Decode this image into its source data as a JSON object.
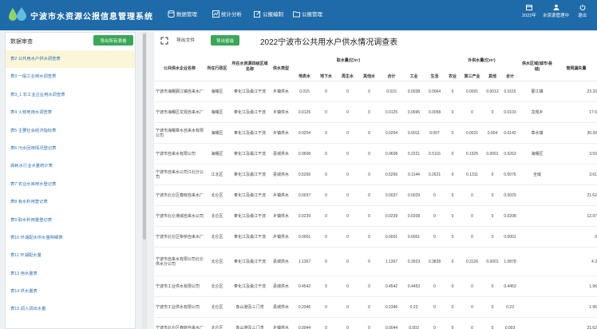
{
  "app": {
    "title": "宁波市水资源公报信息管理系统"
  },
  "nav": [
    {
      "label": "数据管理",
      "icon": "database-icon"
    },
    {
      "label": "统计分析",
      "icon": "chart-icon"
    },
    {
      "label": "公报编制",
      "icon": "edit-icon"
    },
    {
      "label": "公报管理",
      "icon": "folder-icon"
    }
  ],
  "header_right": {
    "year": "2022年",
    "user": "水资源管理中",
    "logout": "退出"
  },
  "sidebar": {
    "title": "数据审查",
    "export_all": "导出所有表格",
    "items": [
      "表2 公共用水户供水调查表",
      "表3 一般工业用水调查表",
      "表3_1 非工业企业用水调查表",
      "表4 火核电用水调查表",
      "表5 主要社会经济指标表",
      "表6 污水回用情况登记表",
      "高耗水行业水量统计表",
      "表7 农业水库用水登记表",
      "表8 有水利用登记表",
      "表9 取水利用量登记表",
      "表10 环湖配水供水量明细表",
      "表11 环湖配水量",
      "表13 用水量表",
      "表14 供水量表",
      "表15 调入调出水量"
    ]
  },
  "main": {
    "export_file": "导出文件",
    "export_sheet": "导出省级",
    "title": "2022宁波市公共用水户供水情况调查表"
  },
  "table": {
    "headers": {
      "company": "公共供水企业名称",
      "district": "所在行政区",
      "zone": "所在水资源四级区域名称",
      "type": "供水类型",
      "intake_group": "取水量(亿m³)",
      "intake_cols": [
        "地表水",
        "地下水",
        "再生水",
        "其他水",
        "合计"
      ],
      "supply_group": "供水量(亿m³)",
      "supply_cols": [
        "工业",
        "生活"
      ],
      "external_group": "外供水量(亿m³)",
      "external_cols": [
        "农业",
        "第三产业",
        "其他",
        "合计"
      ],
      "region": "供水区域(城市/县城)",
      "loss": "管网漏失量"
    },
    "rows": [
      [
        "宁波市海曙鄞江镇自来水厂",
        "海曙区",
        "奉化江及甬江干流",
        "乡镇供水",
        "0.015",
        "0",
        "0",
        "0",
        "0.015",
        "0.0038",
        "0.0064",
        "0",
        "0.0001",
        "0.0012",
        "0.0115",
        "鄞江镇",
        "23.33"
      ],
      [
        "宁波市海曙区龙观自来水厂",
        "海曙区",
        "奉化江及甬江干流",
        "乡镇供水",
        "0.0125",
        "0",
        "0",
        "0",
        "0.0125",
        "0.0045",
        "0.0058",
        "0",
        "0",
        "0",
        "0.0103",
        "龙观乡",
        "17.6"
      ],
      [
        "宁波市海曙章水自来水有限公司",
        "海曙区",
        "奉化江及甬江干流",
        "乡镇供水",
        "0.0204",
        "0",
        "0",
        "0",
        "0.0204",
        "0.0011",
        "0.007",
        "0",
        "0.0021",
        "0.004",
        "0.0142",
        "章水镇",
        "30.39"
      ],
      [
        "宁波市自来水有限公司",
        "海曙区",
        "奉化江及甬江干流",
        "县城供水",
        "0.9608",
        "0",
        "0",
        "0",
        "0.9608",
        "0.2221",
        "0.5116",
        "0",
        "0.1925",
        "0.0001",
        "0.9263",
        "海曙区",
        "3.59"
      ],
      [
        "宁波市自来水公司江北分公司",
        "江北区",
        "奉化江及甬江干流",
        "县城供水",
        "0.5266",
        "0",
        "0",
        "0",
        "0.5266",
        "0.1144",
        "0.2621",
        "0",
        "0.1311",
        "0",
        "0.5076",
        "全域",
        "3.61"
      ],
      [
        "宁波市北仑区春晓自来水厂",
        "北仑区",
        "奉化江及甬江干流",
        "乡镇供水",
        "0.0037",
        "0",
        "0",
        "0",
        "0.0037",
        "0.0029",
        "0",
        "0",
        "0",
        "0",
        "0.0029",
        "",
        "21.62"
      ],
      [
        "宁波市北仑港城自来水公司",
        "北仑区",
        "奉化江及甬江干流",
        "乡镇供水",
        "0.0239",
        "0",
        "0",
        "0",
        "0.0239",
        "0.0208",
        "0",
        "0",
        "0",
        "0",
        "0.0208",
        "",
        "12.97"
      ],
      [
        "宁波市北仑区柴桥自来水厂",
        "北仑区",
        "奉化江及甬江干流",
        "乡镇供水",
        "0.0001",
        "0",
        "0",
        "0",
        "0.0001",
        "0.0001",
        "0",
        "0",
        "0",
        "0",
        "0.0001",
        "",
        "0"
      ],
      [
        "宁波市自来水有限公司北仑供水分公司",
        "北仑区",
        "奉化江及甬江干流",
        "县城供水",
        "1.1367",
        "0",
        "0",
        "0",
        "1.1367",
        "0.3923",
        "0.3828",
        "0",
        "0.3126",
        "0.0001",
        "1.0878",
        "",
        "4.3"
      ],
      [
        "宁波市工业供水有限公司",
        "北仑区",
        "奉化江及甬江干流",
        "县城供水",
        "0.4542",
        "0",
        "0",
        "0",
        "0.4542",
        "0.4453",
        "0",
        "0",
        "0",
        "0",
        "0.4453",
        "",
        "1.96"
      ],
      [
        "宁波市工业供水有限公司",
        "北仑区",
        "象山港及三门湾",
        "县城供水",
        "0.2346",
        "0",
        "0",
        "0",
        "0.2346",
        "0.23",
        "0",
        "0",
        "0",
        "0",
        "0.23",
        "",
        "1.96"
      ],
      [
        "宁波市北仑区春晓自来水厂",
        "北仑区",
        "象山港及三门湾",
        "乡镇供水",
        "0.0044",
        "0",
        "0",
        "0",
        "0.0044",
        "0.003",
        "0",
        "0",
        "0",
        "0",
        "0.003",
        "",
        "21.62"
      ]
    ]
  },
  "colors": {
    "header_bg": "#1f6aa8",
    "button_green": "#3aa757",
    "link_blue": "#2e6fb0",
    "active_bg": "#fbf6d9"
  }
}
